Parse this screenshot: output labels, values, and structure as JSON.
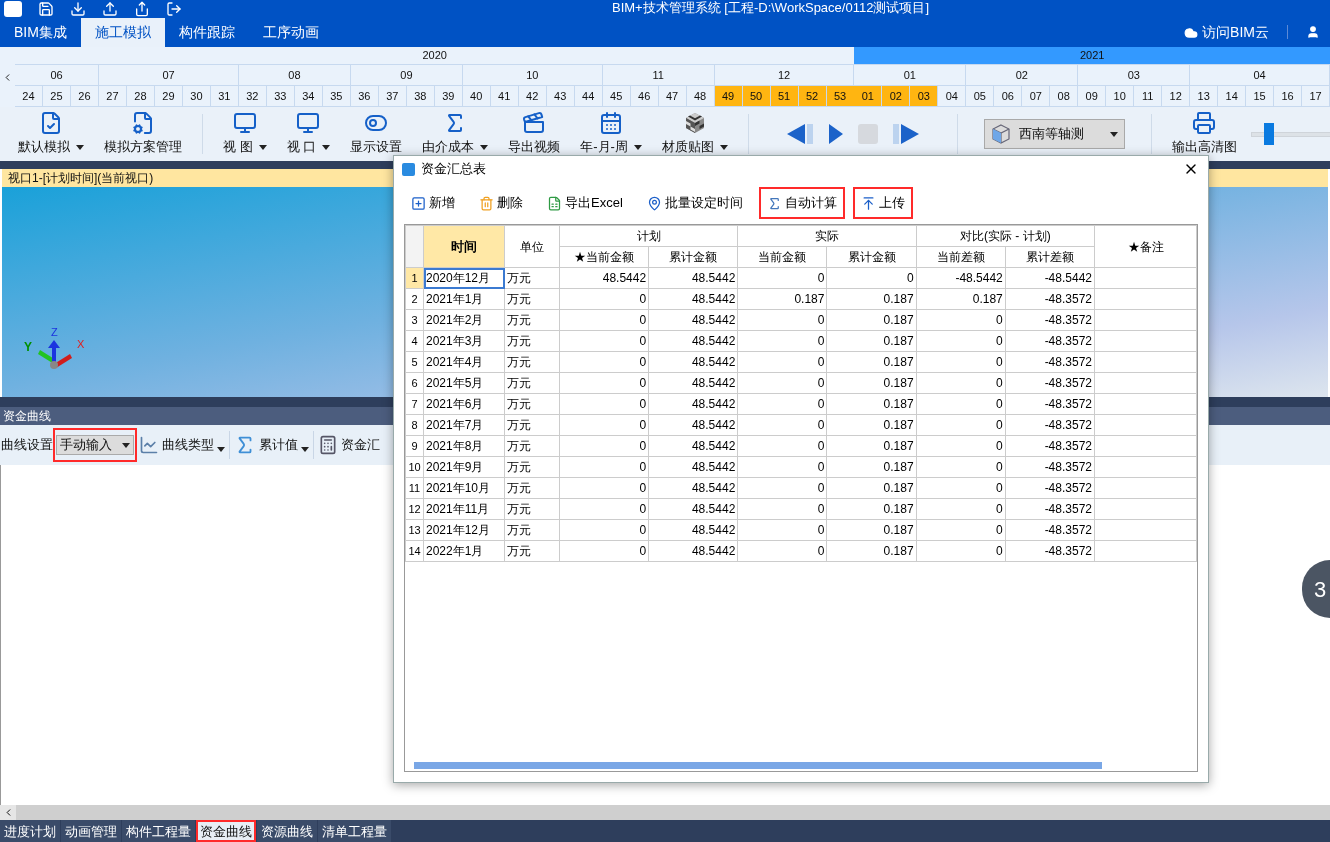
{
  "app": {
    "title": "BIM+技术管理系统 [工程-D:\\WorkSpace/0112测试项目]",
    "tabs": [
      {
        "label": "BIM集成",
        "selected": false
      },
      {
        "label": "施工模拟",
        "selected": true
      },
      {
        "label": "构件跟踪",
        "selected": false
      },
      {
        "label": "工序动画",
        "selected": false
      }
    ],
    "cloud_link": "访问BIM云"
  },
  "timeline": {
    "years": [
      {
        "label": "2020",
        "selected": false,
        "months": [
          {
            "label": "06",
            "weeks": [
              {
                "label": "24",
                "highlighted": false
              },
              {
                "label": "25",
                "highlighted": false
              },
              {
                "label": "26",
                "highlighted": false
              }
            ]
          },
          {
            "label": "07",
            "weeks": [
              {
                "label": "27",
                "highlighted": false
              },
              {
                "label": "28",
                "highlighted": false
              },
              {
                "label": "29",
                "highlighted": false
              },
              {
                "label": "30",
                "highlighted": false
              },
              {
                "label": "31",
                "highlighted": false
              }
            ]
          },
          {
            "label": "08",
            "weeks": [
              {
                "label": "32",
                "highlighted": false
              },
              {
                "label": "33",
                "highlighted": false
              },
              {
                "label": "34",
                "highlighted": false
              },
              {
                "label": "35",
                "highlighted": false
              }
            ]
          },
          {
            "label": "09",
            "weeks": [
              {
                "label": "36",
                "highlighted": false
              },
              {
                "label": "37",
                "highlighted": false
              },
              {
                "label": "38",
                "highlighted": false
              },
              {
                "label": "39",
                "highlighted": false
              }
            ]
          },
          {
            "label": "10",
            "weeks": [
              {
                "label": "40",
                "highlighted": false
              },
              {
                "label": "41",
                "highlighted": false
              },
              {
                "label": "42",
                "highlighted": false
              },
              {
                "label": "43",
                "highlighted": false
              },
              {
                "label": "44",
                "highlighted": false
              }
            ]
          },
          {
            "label": "11",
            "weeks": [
              {
                "label": "45",
                "highlighted": false
              },
              {
                "label": "46",
                "highlighted": false
              },
              {
                "label": "47",
                "highlighted": false
              },
              {
                "label": "48",
                "highlighted": false
              }
            ]
          },
          {
            "label": "12",
            "weeks": [
              {
                "label": "49",
                "highlighted": true
              },
              {
                "label": "50",
                "highlighted": true
              },
              {
                "label": "51",
                "highlighted": true
              },
              {
                "label": "52",
                "highlighted": true
              },
              {
                "label": "53",
                "highlighted": true
              }
            ]
          }
        ]
      },
      {
        "label": "2021",
        "selected": true,
        "months": [
          {
            "label": "01",
            "weeks": [
              {
                "label": "01",
                "highlighted": true
              },
              {
                "label": "02",
                "highlighted": true
              },
              {
                "label": "03",
                "highlighted": true
              },
              {
                "label": "04",
                "highlighted": false
              }
            ]
          },
          {
            "label": "02",
            "weeks": [
              {
                "label": "05",
                "highlighted": false
              },
              {
                "label": "06",
                "highlighted": false
              },
              {
                "label": "07",
                "highlighted": false
              },
              {
                "label": "08",
                "highlighted": false
              }
            ]
          },
          {
            "label": "03",
            "weeks": [
              {
                "label": "09",
                "highlighted": false
              },
              {
                "label": "10",
                "highlighted": false
              },
              {
                "label": "11",
                "highlighted": false
              },
              {
                "label": "12",
                "highlighted": false
              }
            ]
          },
          {
            "label": "04",
            "weeks": [
              {
                "label": "13",
                "highlighted": false
              },
              {
                "label": "14",
                "highlighted": false
              },
              {
                "label": "15",
                "highlighted": false
              },
              {
                "label": "16",
                "highlighted": false
              },
              {
                "label": "17",
                "highlighted": false
              }
            ]
          }
        ]
      }
    ]
  },
  "toolbar": {
    "items": [
      {
        "kind": "button",
        "label": "默认模拟",
        "dropdown": true
      },
      {
        "kind": "button",
        "label": "模拟方案管理",
        "dropdown": false
      },
      {
        "kind": "separator"
      },
      {
        "kind": "button",
        "label": "视 图",
        "dropdown": true
      },
      {
        "kind": "button",
        "label": "视 口",
        "dropdown": true
      },
      {
        "kind": "button",
        "label": "显示设置",
        "dropdown": false
      },
      {
        "kind": "button",
        "label": "由介成本",
        "dropdown": true
      },
      {
        "kind": "button",
        "label": "导出视频",
        "dropdown": false
      },
      {
        "kind": "button",
        "label": "年-月-周",
        "dropdown": true
      },
      {
        "kind": "button",
        "label": "材质贴图",
        "dropdown": true
      },
      {
        "kind": "separator"
      },
      {
        "kind": "playback",
        "controls": [
          {
            "kind": "previous",
            "disabled": false
          },
          {
            "kind": "play",
            "disabled": false
          },
          {
            "kind": "stop",
            "disabled": true
          },
          {
            "kind": "next",
            "disabled": false
          }
        ]
      },
      {
        "kind": "separator"
      },
      {
        "kind": "select",
        "value": "西南等轴测"
      },
      {
        "kind": "separator"
      },
      {
        "kind": "button",
        "label": "输出高清图",
        "dropdown": false
      },
      {
        "kind": "slider",
        "level": 0.2
      }
    ]
  },
  "viewport": {
    "title": "视口1-[计划时间](当前视口)",
    "axes": {
      "x": "X",
      "y": "Y",
      "z": "Z"
    }
  },
  "curve_panel": {
    "title": "资金曲线",
    "setting_label": "曲线设置",
    "mode": {
      "value": "手动输入",
      "highlighted": true
    },
    "tools": [
      {
        "label": "曲线类型",
        "dropdown": true
      },
      {
        "label": "累计值",
        "dropdown": true
      },
      {
        "label": "资金汇",
        "dropdown": false
      }
    ]
  },
  "bottom_tabs": [
    {
      "label": "进度计划",
      "selected": false,
      "highlighted": false
    },
    {
      "label": "动画管理",
      "selected": false,
      "highlighted": false
    },
    {
      "label": "构件工程量",
      "selected": false,
      "highlighted": false
    },
    {
      "label": "资金曲线",
      "selected": true,
      "highlighted": true
    },
    {
      "label": "资源曲线",
      "selected": false,
      "highlighted": false
    },
    {
      "label": "清单工程量",
      "selected": false,
      "highlighted": false
    }
  ],
  "floating_badge": "3",
  "dialog": {
    "title": "资金汇总表",
    "tools": [
      {
        "label": "新增",
        "highlighted": false
      },
      {
        "label": "删除",
        "highlighted": false
      },
      {
        "label": "导出Excel",
        "highlighted": false
      },
      {
        "label": "批量设定时间",
        "highlighted": false
      },
      {
        "label": "自动计算",
        "highlighted": true
      },
      {
        "label": "上传",
        "highlighted": true
      }
    ],
    "table": {
      "columns": [
        {
          "kind": "index"
        },
        {
          "label": "时间",
          "kind": "key"
        },
        {
          "label": "单位",
          "kind": "plain"
        },
        {
          "label": "★当前金额",
          "kind": "sub"
        },
        {
          "label": "累计金额",
          "kind": "sub"
        },
        {
          "label": "当前金额",
          "kind": "sub"
        },
        {
          "label": "累计金额",
          "kind": "sub"
        },
        {
          "label": "当前差额",
          "kind": "sub"
        },
        {
          "label": "累计差额",
          "kind": "sub"
        },
        {
          "label": "★备注",
          "kind": "plain"
        }
      ],
      "column_groups": [
        {
          "label": "计划"
        },
        {
          "label": "实际"
        },
        {
          "label": "对比(实际 - 计划)"
        }
      ],
      "rows": [
        {
          "selected": true,
          "cells": [
            "1",
            "2020年12月",
            "万元",
            "48.5442",
            "48.5442",
            "0",
            "0",
            "-48.5442",
            "-48.5442"
          ]
        },
        {
          "selected": false,
          "cells": [
            "2",
            "2021年1月",
            "万元",
            "0",
            "48.5442",
            "0.187",
            "0.187",
            "0.187",
            "-48.3572"
          ]
        },
        {
          "selected": false,
          "cells": [
            "3",
            "2021年2月",
            "万元",
            "0",
            "48.5442",
            "0",
            "0.187",
            "0",
            "-48.3572"
          ]
        },
        {
          "selected": false,
          "cells": [
            "4",
            "2021年3月",
            "万元",
            "0",
            "48.5442",
            "0",
            "0.187",
            "0",
            "-48.3572"
          ]
        },
        {
          "selected": false,
          "cells": [
            "5",
            "2021年4月",
            "万元",
            "0",
            "48.5442",
            "0",
            "0.187",
            "0",
            "-48.3572"
          ]
        },
        {
          "selected": false,
          "cells": [
            "6",
            "2021年5月",
            "万元",
            "0",
            "48.5442",
            "0",
            "0.187",
            "0",
            "-48.3572"
          ]
        },
        {
          "selected": false,
          "cells": [
            "7",
            "2021年6月",
            "万元",
            "0",
            "48.5442",
            "0",
            "0.187",
            "0",
            "-48.3572"
          ]
        },
        {
          "selected": false,
          "cells": [
            "8",
            "2021年7月",
            "万元",
            "0",
            "48.5442",
            "0",
            "0.187",
            "0",
            "-48.3572"
          ]
        },
        {
          "selected": false,
          "cells": [
            "9",
            "2021年8月",
            "万元",
            "0",
            "48.5442",
            "0",
            "0.187",
            "0",
            "-48.3572"
          ]
        },
        {
          "selected": false,
          "cells": [
            "10",
            "2021年9月",
            "万元",
            "0",
            "48.5442",
            "0",
            "0.187",
            "0",
            "-48.3572"
          ]
        },
        {
          "selected": false,
          "cells": [
            "11",
            "2021年10月",
            "万元",
            "0",
            "48.5442",
            "0",
            "0.187",
            "0",
            "-48.3572"
          ]
        },
        {
          "selected": false,
          "cells": [
            "12",
            "2021年11月",
            "万元",
            "0",
            "48.5442",
            "0",
            "0.187",
            "0",
            "-48.3572"
          ]
        },
        {
          "selected": false,
          "cells": [
            "13",
            "2021年12月",
            "万元",
            "0",
            "48.5442",
            "0",
            "0.187",
            "0",
            "-48.3572"
          ]
        },
        {
          "selected": false,
          "cells": [
            "14",
            "2022年1月",
            "万元",
            "0",
            "48.5442",
            "0",
            "0.187",
            "0",
            "-48.3572"
          ]
        }
      ]
    }
  }
}
